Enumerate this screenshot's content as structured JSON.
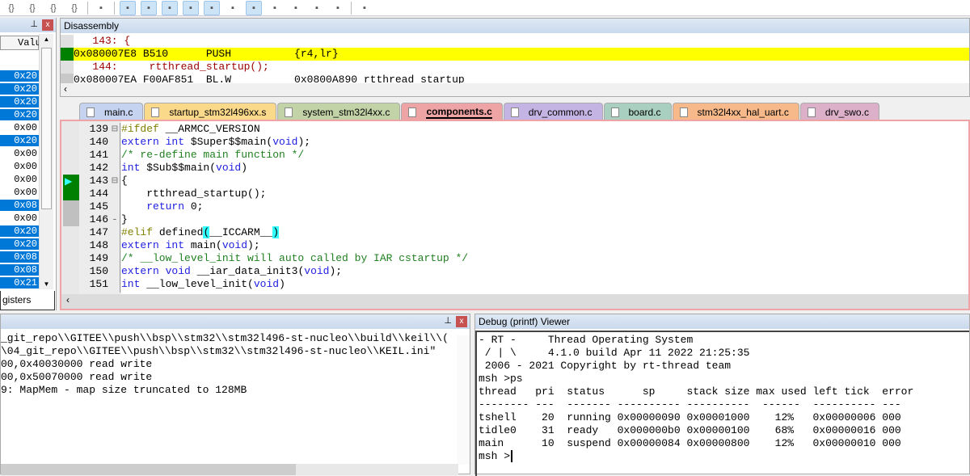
{
  "toolbar": {
    "icons": [
      "brace-step-into-icon",
      "brace-step-over-icon",
      "brace-step-out-icon",
      "run-to-cursor-icon",
      "show-next-statement-icon",
      "command-window-icon",
      "disassembly-window-icon",
      "symbols-window-icon",
      "registers-window-icon",
      "call-stack-icon",
      "watch-window-icon",
      "memory-window-icon",
      "serial-window-icon",
      "analysis-window-icon",
      "trace-window-icon",
      "system-viewer-icon",
      "toolbox-icon"
    ]
  },
  "left_panel": {
    "column_header": "Valu",
    "values": [
      "0x20",
      "0x20",
      "0x20",
      "0x20",
      "0x00",
      "0x20",
      "0x00",
      "0x00",
      "0x00",
      "0x00",
      "0x08",
      "0x00",
      "0x20",
      "0x20",
      "0x08",
      "0x08",
      "0x21"
    ],
    "selected": [
      true,
      true,
      true,
      true,
      false,
      true,
      false,
      false,
      false,
      false,
      true,
      false,
      true,
      true,
      true,
      true,
      true
    ],
    "tab_label": "gisters"
  },
  "disassembly": {
    "title": "Disassembly",
    "lines": [
      {
        "text": "   143: {",
        "type": "src"
      },
      {
        "text": "0x080007E8 B510      PUSH          {r4,lr}",
        "type": "current"
      },
      {
        "text": "   144:     rtthread_startup();",
        "type": "src"
      },
      {
        "text": "0x080007EA F00AF851  BL.W          0x0800A890 rtthread_startup",
        "type": "asm"
      }
    ]
  },
  "tabs": [
    {
      "label": "main.c",
      "color": "#c5d3f0"
    },
    {
      "label": "startup_stm32l496xx.s",
      "color": "#fbd98a"
    },
    {
      "label": "system_stm32l4xx.c",
      "color": "#c3d3a8"
    },
    {
      "label": "components.c",
      "color": "#eea4a4",
      "active": true
    },
    {
      "label": "drv_common.c",
      "color": "#c4b4e4"
    },
    {
      "label": "board.c",
      "color": "#a8cfc0"
    },
    {
      "label": "stm32l4xx_hal_uart.c",
      "color": "#f7b98a"
    },
    {
      "label": "drv_swo.c",
      "color": "#dcb0c8"
    }
  ],
  "editor": {
    "lines": [
      {
        "n": "139",
        "html": "<span class='pp'>#ifdef</span> __ARMCC_VERSION"
      },
      {
        "n": "140",
        "html": "<span class='kw'>extern int</span> $Super$$main(<span class='kw'>void</span>);"
      },
      {
        "n": "141",
        "html": "<span class='cm'>/* re-define main function */</span>"
      },
      {
        "n": "142",
        "html": "<span class='kw'>int</span> $Sub$$main(<span class='kw'>void</span>)"
      },
      {
        "n": "143",
        "html": "{"
      },
      {
        "n": "144",
        "html": "    rtthread_startup();"
      },
      {
        "n": "145",
        "html": "    <span class='kw'>return</span> 0;"
      },
      {
        "n": "146",
        "html": "}"
      },
      {
        "n": "147",
        "html": "<span class='pp'>#elif</span> defined<span style='background:#3ff'>(</span>__ICCARM__<span style='background:#3ff'>)</span>"
      },
      {
        "n": "148",
        "html": "<span class='kw'>extern int</span> main(<span class='kw'>void</span>);"
      },
      {
        "n": "149",
        "html": "<span class='cm'>/* __low_level_init will auto called by IAR cstartup */</span>"
      },
      {
        "n": "150",
        "html": "<span class='kw'>extern void</span> __iar_data_init3(<span class='kw'>void</span>);"
      },
      {
        "n": "151",
        "html": "<span class='kw'>int</span> __low_level_init(<span class='kw'>void</span>)"
      }
    ]
  },
  "command": {
    "lines": [
      "_git_repo\\\\GITEE\\\\push\\\\bsp\\\\stm32\\\\stm32l496-st-nucleo\\\\build\\\\keil\\\\(",
      "\\04_git_repo\\\\GITEE\\\\push\\\\bsp\\\\stm32\\\\stm32l496-st-nucleo\\\\KEIL.ini\"",
      "00,0x40030000 read write",
      "00,0x50070000 read write",
      "9: MapMem - map size truncated to 128MB"
    ]
  },
  "debug_viewer": {
    "title": "Debug (printf) Viewer",
    "lines": [
      "- RT -     Thread Operating System",
      " / | \\     4.1.0 build Apr 11 2022 21:25:35",
      " 2006 - 2021 Copyright by rt-thread team",
      "msh >ps",
      "thread   pri  status      sp     stack size max used left tick  error",
      "-------- ---  ------- ---------- ----------  ------  ---------- ---",
      "tshell    20  running 0x00000090 0x00001000    12%   0x00000006 000",
      "tidle0    31  ready   0x000000b0 0x00000100    68%   0x00000016 000",
      "main      10  suspend 0x00000084 0x00000800    12%   0x00000010 000",
      "msh >"
    ]
  }
}
